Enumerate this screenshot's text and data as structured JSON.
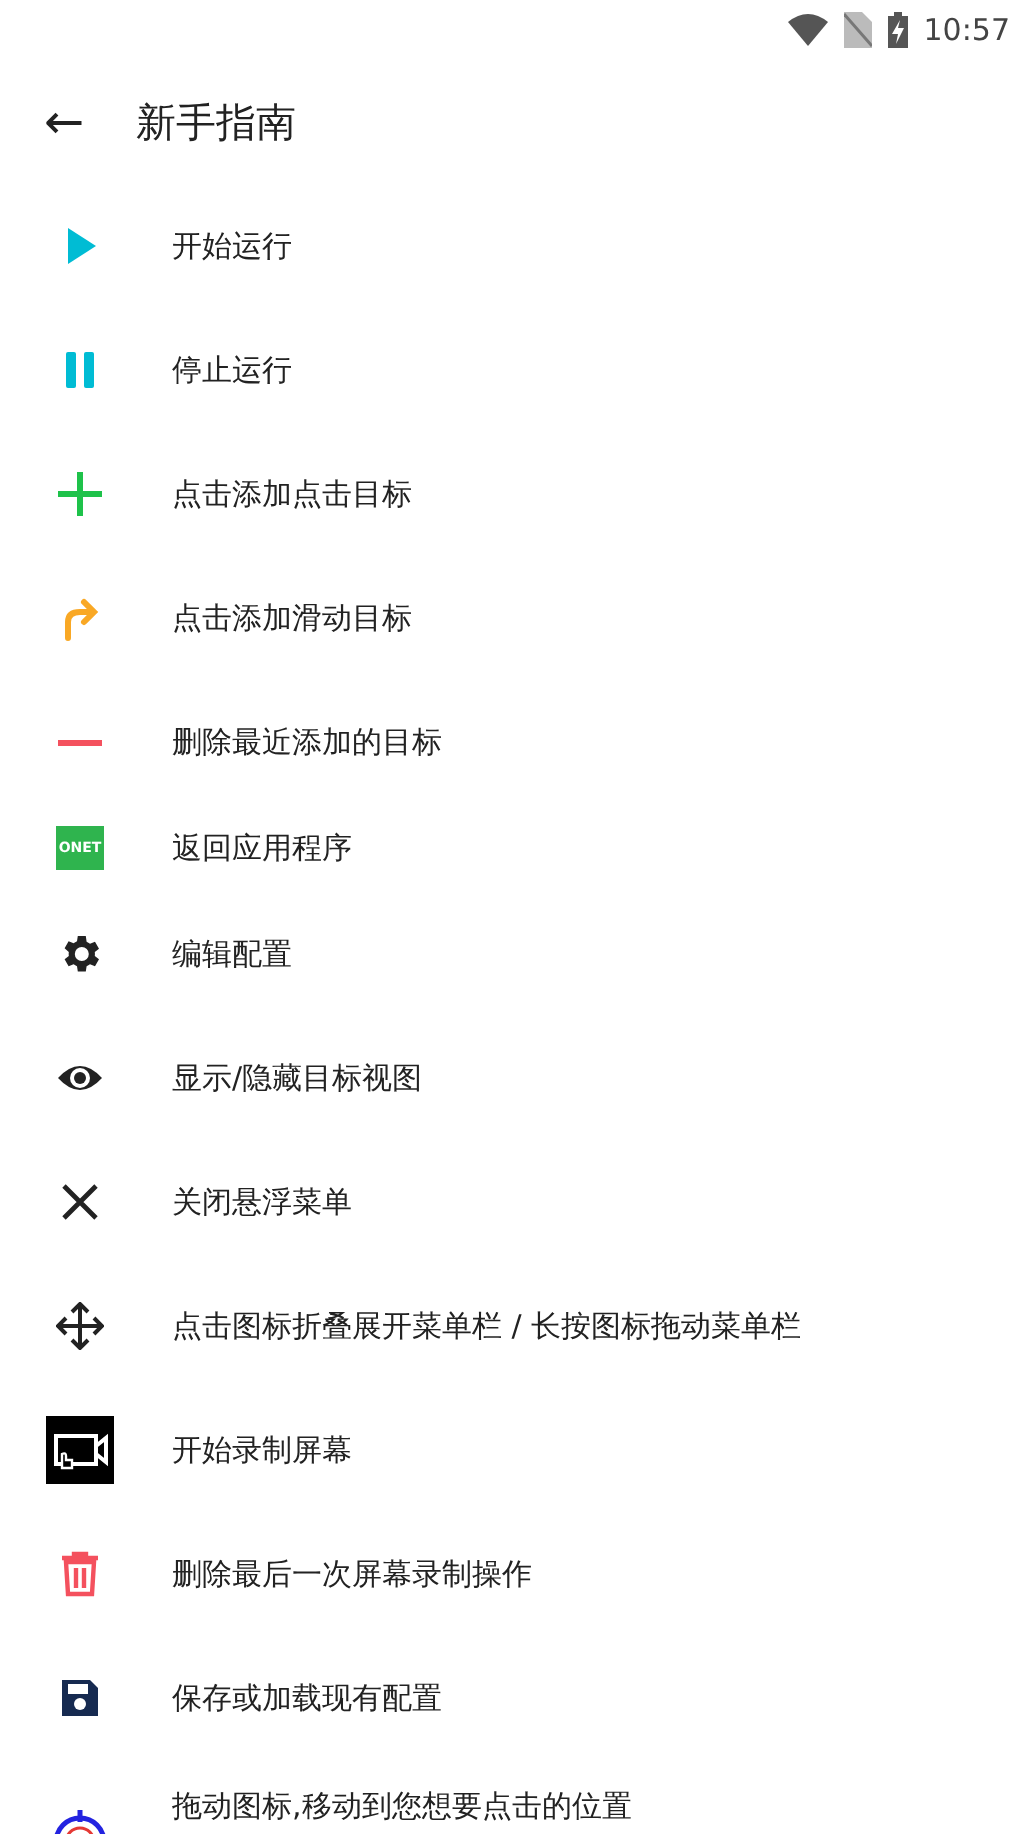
{
  "status_bar": {
    "time": "10:57"
  },
  "toolbar": {
    "back": "←",
    "title": "新手指南"
  },
  "items": [
    {
      "kind": "play",
      "label": "开始运行"
    },
    {
      "kind": "pause",
      "label": "停止运行"
    },
    {
      "kind": "plus",
      "label": "点击添加点击目标"
    },
    {
      "kind": "swipe",
      "label": "点击添加滑动目标"
    },
    {
      "kind": "minus",
      "label": "删除最近添加的目标"
    },
    {
      "kind": "app",
      "label": "返回应用程序",
      "icon_text": "ONET"
    },
    {
      "kind": "gear",
      "label": "编辑配置"
    },
    {
      "kind": "eye",
      "label": "显示/隐藏目标视图"
    },
    {
      "kind": "close",
      "label": "关闭悬浮菜单"
    },
    {
      "kind": "move",
      "label": "点击图标折叠展开菜单栏 / 长按图标拖动菜单栏"
    },
    {
      "kind": "record",
      "label": "开始录制屏幕"
    },
    {
      "kind": "trash",
      "label": "删除最后一次屏幕录制操作"
    },
    {
      "kind": "save",
      "label": "保存或加载现有配置"
    },
    {
      "kind": "target",
      "label": "拖动图标,移动到您想要点击的位置"
    }
  ]
}
